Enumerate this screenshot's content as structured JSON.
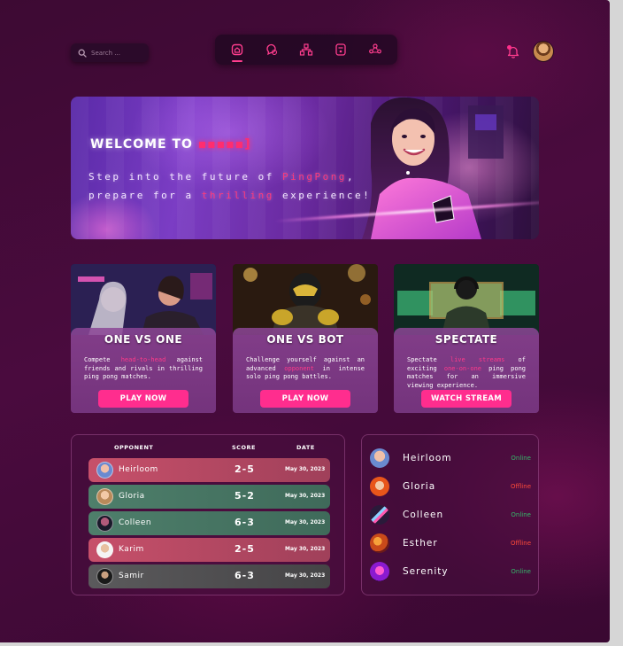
{
  "search": {
    "placeholder": "Search ..."
  },
  "nav": {
    "items": [
      {
        "icon": "home-icon",
        "active": true
      },
      {
        "icon": "chat-icon",
        "active": false
      },
      {
        "icon": "tournament-icon",
        "active": false
      },
      {
        "icon": "game-icon",
        "active": false
      },
      {
        "icon": "friends-icon",
        "active": false
      }
    ]
  },
  "hero": {
    "title": "WELCOME TO",
    "title_accent": "▪▪▪▪▪]",
    "line1_a": "Step into the future of ",
    "line1_hl": "PingPong",
    "line1_b": ",",
    "line2_a": "prepare for a ",
    "line2_hl": "thrilling",
    "line2_b": " experience!"
  },
  "modes": [
    {
      "title": "ONE VS ONE",
      "desc_a": "Compete ",
      "desc_hl": "head-to-head",
      "desc_b": " against friends and rivals in thrilling ping pong matches.",
      "button": "PLAY NOW"
    },
    {
      "title": "ONE VS BOT",
      "desc_a": "Challenge yourself against an advanced ",
      "desc_hl": "opponent",
      "desc_b": " in intense solo ping pong battles.",
      "button": "PLAY NOW"
    },
    {
      "title": "SPECTATE",
      "desc_a": "Spectate ",
      "desc_hl": "live streams",
      "desc_b": " of exciting ",
      "desc_hl2": "one-on-one",
      "desc_c": " ping pong matches for an immersive viewing experience.",
      "button": "WATCH STREAM"
    }
  ],
  "matches": {
    "headers": {
      "opponent": "OPPONENT",
      "score": "SCORE",
      "date": "DATE"
    },
    "rows": [
      {
        "name": "Heirloom",
        "score": "2-5",
        "date": "May 30, 2023",
        "result": "loss"
      },
      {
        "name": "Gloria",
        "score": "5-2",
        "date": "May 30, 2023",
        "result": "win"
      },
      {
        "name": "Colleen",
        "score": "6-3",
        "date": "May 30, 2023",
        "result": "win"
      },
      {
        "name": "Karim",
        "score": "2-5",
        "date": "May 30, 2023",
        "result": "loss"
      },
      {
        "name": "Samir",
        "score": "6-3",
        "date": "May 30, 2023",
        "result": "neutral"
      }
    ]
  },
  "friends": [
    {
      "name": "Heirloom",
      "status": "Online"
    },
    {
      "name": "Gloria",
      "status": "Offline"
    },
    {
      "name": "Colleen",
      "status": "Online"
    },
    {
      "name": "Esther",
      "status": "Offline"
    },
    {
      "name": "Serenity",
      "status": "Online"
    }
  ],
  "colors": {
    "accent": "#ff2d8e",
    "online": "#35b86a",
    "offline": "#ff4a3a",
    "background": "#430b39"
  }
}
